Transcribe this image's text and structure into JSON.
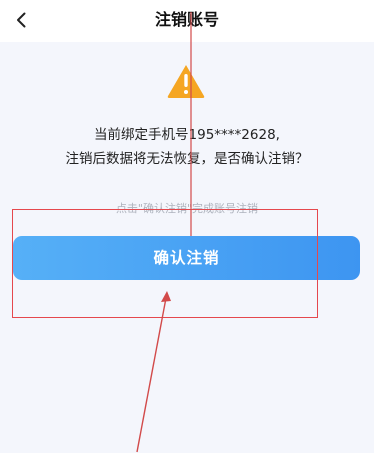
{
  "header": {
    "title": "注销账号",
    "back_icon": "chevron-left-icon"
  },
  "warning": {
    "icon": "warning-triangle-icon",
    "color": "#f5a623"
  },
  "message": {
    "line1": "当前绑定手机号195****2628,",
    "line2": "注销后数据将无法恢复，是否确认注销？"
  },
  "hint": "点击\"确认注销\"完成账号注销",
  "confirm_button": {
    "label": "确认注销",
    "color": "#4aa3f5"
  },
  "annotation": {
    "color": "#e5484d"
  }
}
